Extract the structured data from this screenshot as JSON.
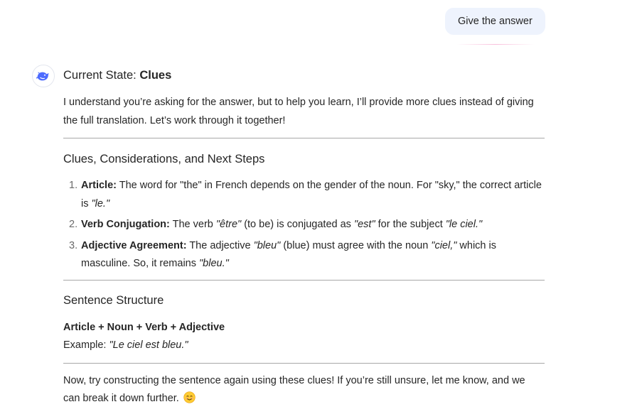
{
  "user_message": "Give the answer",
  "assistant": {
    "state_label": "Current State:",
    "state_value": "Clues",
    "intro": "I understand you’re asking for the answer, but to help you learn, I’ll provide more clues instead of giving the full translation. Let’s work through it together!",
    "section1_title": "Clues, Considerations, and Next Steps",
    "clues": [
      {
        "num": "1.",
        "label": "Article:",
        "t1": " The word for \"the\" in French depends on the gender of the noun. For \"sky,\" the correct article is ",
        "i1": "\"le.\"",
        "t2": "",
        "i2": "",
        "t3": "",
        "i3": "",
        "t4": ""
      },
      {
        "num": "2.",
        "label": "Verb Conjugation:",
        "t1": " The verb ",
        "i1": "\"être\"",
        "t2": " (to be) is conjugated as ",
        "i2": "\"est\"",
        "t3": " for the subject ",
        "i3": "\"le ciel.\"",
        "t4": ""
      },
      {
        "num": "3.",
        "label": "Adjective Agreement:",
        "t1": " The adjective ",
        "i1": "\"bleu\"",
        "t2": " (blue) must agree with the noun ",
        "i2": "\"ciel,\"",
        "t3": " which is masculine. So, it remains ",
        "i3": "\"bleu.\"",
        "t4": ""
      }
    ],
    "section2_title": "Sentence Structure",
    "formula": "Article + Noun + Verb + Adjective",
    "example_label": "Example: ",
    "example_value": "\"Le ciel est bleu.\"",
    "closing": "Now, try constructing the sentence again using these clues! If you’re still unsure, let me know, and we can break it down further. "
  },
  "icons": {
    "avatar": "deepseek-whale-logo-icon",
    "emoji": "smiling-face-emoji-icon"
  },
  "colors": {
    "user_bubble_bg": "#eef3fd",
    "logo_blue": "#4d6bfe",
    "divider": "#a8a8a8",
    "text": "#262626"
  }
}
